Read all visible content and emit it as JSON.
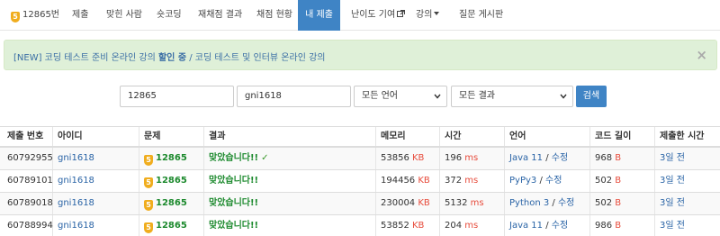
{
  "nav": {
    "problem_label": "12865번",
    "items": [
      "제출",
      "맞힌 사람",
      "숏코딩",
      "재채점 결과",
      "채점 현황",
      "내 제출",
      "난이도 기여",
      "강의",
      "질문 게시판"
    ],
    "active": "내 제출"
  },
  "alert": {
    "prefix": "[NEW] 코딩 테스트 준비 온라인 강의 ",
    "highlight": "할인 중",
    "suffix": " / 코딩 테스트 및 인터뷰 온라인 강의",
    "close": "×"
  },
  "filter": {
    "problem_id": "12865",
    "user_id": "gni1618",
    "language": "모든 언어",
    "result": "모든 결과",
    "search_label": "검색"
  },
  "table": {
    "headers": [
      "제출 번호",
      "아이디",
      "문제",
      "결과",
      "메모리",
      "시간",
      "언어",
      "코드 길이",
      "제출한 시간"
    ],
    "rows": [
      {
        "id": "60792955",
        "user": "gni1618",
        "problem": "12865",
        "result": "맞았습니다!!",
        "memory": "53856",
        "memory_unit": "KB",
        "time": "196",
        "time_unit": "ms",
        "lang": "Java 11",
        "edit": "수정",
        "code_len": "968",
        "code_unit": "B",
        "submitted": "3일 전"
      },
      {
        "id": "60789101",
        "user": "gni1618",
        "problem": "12865",
        "result": "맞았습니다!!",
        "memory": "194456",
        "memory_unit": "KB",
        "time": "372",
        "time_unit": "ms",
        "lang": "PyPy3",
        "edit": "수정",
        "code_len": "502",
        "code_unit": "B",
        "submitted": "3일 전"
      },
      {
        "id": "60789018",
        "user": "gni1618",
        "problem": "12865",
        "result": "맞았습니다!!",
        "memory": "230004",
        "memory_unit": "KB",
        "time": "5132",
        "time_unit": "ms",
        "lang": "Python 3",
        "edit": "수정",
        "code_len": "502",
        "code_unit": "B",
        "submitted": "3일 전"
      },
      {
        "id": "60788994",
        "user": "gni1618",
        "problem": "12865",
        "result": "맞았습니다!!",
        "memory": "53852",
        "memory_unit": "KB",
        "time": "204",
        "time_unit": "ms",
        "lang": "Java 11",
        "edit": "수정",
        "code_len": "986",
        "code_unit": "B",
        "submitted": "3일 전"
      }
    ]
  },
  "colors": {
    "accent": "#3f84c5",
    "success": "#1d8a2e",
    "unit": "#e74c3c",
    "tier_gold": "#f0ad1e",
    "alert_bg": "#dff0d8"
  }
}
